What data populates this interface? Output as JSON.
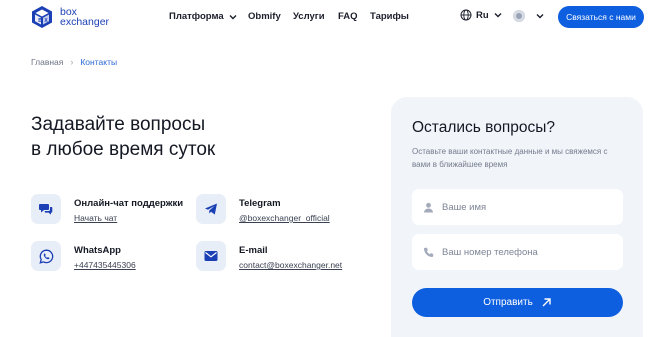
{
  "brand": {
    "line1": "box",
    "line2": "exchanger"
  },
  "nav": {
    "items": [
      {
        "label": "Платформа",
        "has_dropdown": true
      },
      {
        "label": "Obmify",
        "has_dropdown": false
      },
      {
        "label": "Услуги",
        "has_dropdown": false
      },
      {
        "label": "FAQ",
        "has_dropdown": false
      },
      {
        "label": "Тарифы",
        "has_dropdown": false
      }
    ],
    "language": "Ru",
    "contact_button": "Связаться с нами"
  },
  "breadcrumb": {
    "home": "Главная",
    "current": "Контакты"
  },
  "hero": {
    "title_line1": "Задавайте вопросы",
    "title_line2": "в любое время суток"
  },
  "contacts": [
    {
      "label": "Онлайн-чат поддержки",
      "link": "Начать чат",
      "icon": "chat-icon"
    },
    {
      "label": "Telegram",
      "link": "@boxexchanger_official",
      "icon": "telegram-icon"
    },
    {
      "label": "WhatsApp",
      "link": "+447435445306",
      "icon": "whatsapp-icon"
    },
    {
      "label": "E-mail",
      "link": "contact@boxexchanger.net",
      "icon": "mail-icon"
    }
  ],
  "form": {
    "title": "Остались вопросы?",
    "subtitle": "Оставьте ваши контактные данные и мы свяжемся с вами в ближайшее время",
    "name_placeholder": "Ваше имя",
    "phone_placeholder": "Ваш номер телефона",
    "submit_label": "Отправить"
  },
  "colors": {
    "accent": "#0d5fe0",
    "brand": "#1b3fb4",
    "card_bg": "#f1f4f9",
    "icon_bg": "#e8eef8"
  }
}
